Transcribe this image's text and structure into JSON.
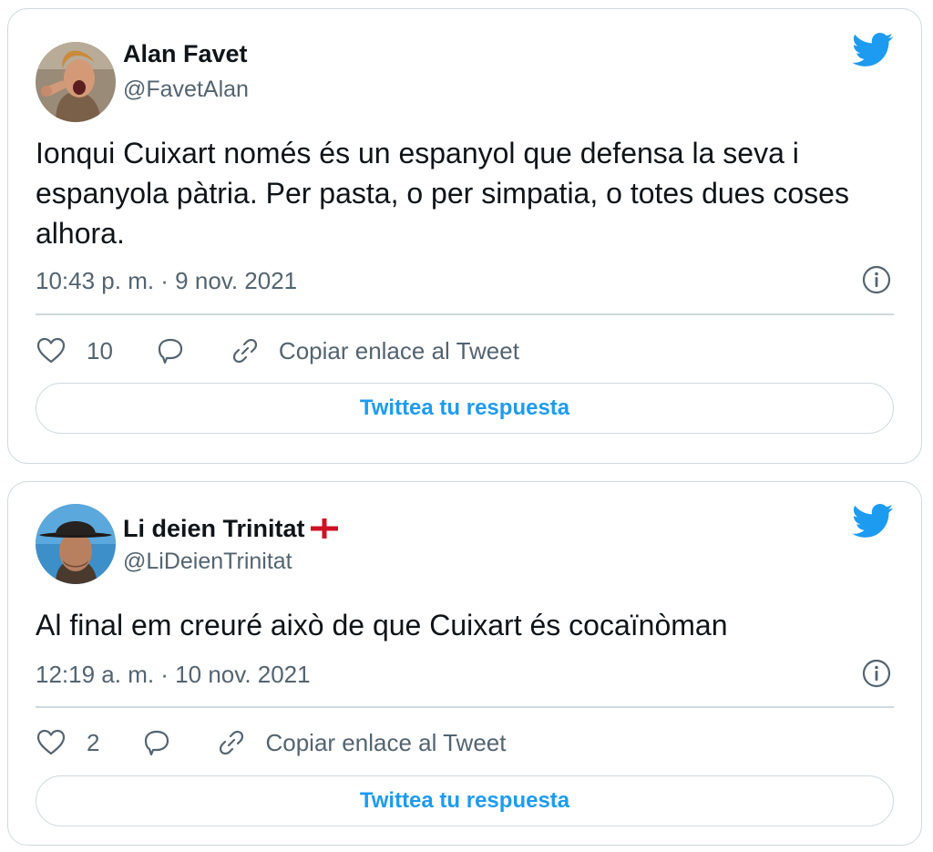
{
  "tweets": [
    {
      "author": "Alan Favet",
      "handle": "@FavetAlan",
      "text": "Ionqui Cuixart només és un espanyol que defensa la seva i espanyola pàtria. Per pasta, o per simpatia, o totes dues coses alhora.",
      "timestamp": "10:43 p. m. · 9 nov. 2021",
      "likes": "10",
      "copy_link_label": "Copiar enlace al Tweet",
      "reply_button_label": "Twittea tu respuesta",
      "avatar_icon": "avatar-photo-shouting-man",
      "has_flag": false
    },
    {
      "author": "Li deien Trinitat",
      "handle": "@LiDeienTrinitat",
      "text": "Al final em creuré això de que Cuixart és cocaïnòman",
      "timestamp": "12:19 a. m. · 10 nov. 2021",
      "likes": "2",
      "copy_link_label": "Copiar enlace al Tweet",
      "reply_button_label": "Twittea tu respuesta",
      "avatar_icon": "avatar-photo-cowboy",
      "has_flag": true,
      "flag_icon": "england-flag-icon"
    }
  ],
  "icons": {
    "brand": "twitter-bird-icon",
    "info": "info-icon",
    "like": "heart-icon",
    "reply": "reply-bubble-icon",
    "copy_link": "link-icon"
  },
  "colors": {
    "brand_blue": "#1d9bf0",
    "text_primary": "#0f1419",
    "text_secondary": "#536471",
    "border": "#cfd9de",
    "flag_red": "#ce1124"
  }
}
